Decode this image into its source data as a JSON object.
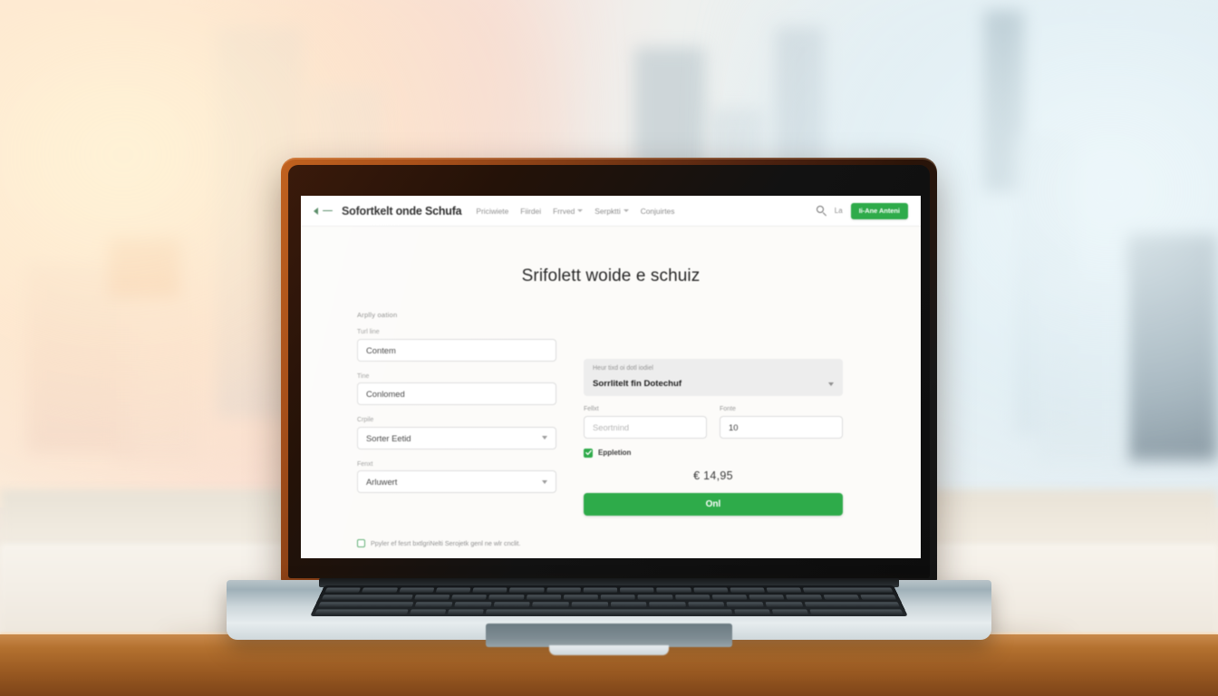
{
  "scene": {
    "description": "laptop on wooden desk in front of blurred city window",
    "accent_green": "#2eab4a",
    "bezel_color": "#a8501a",
    "desk_wood_color": "#b4712f"
  },
  "browser": {
    "nav": {
      "back_icon": "chevron-left-icon",
      "divider_icon": "dash-icon",
      "brand": "Sofortkelt onde Schufa",
      "links": [
        {
          "label": "Priciwiete",
          "has_caret": false
        },
        {
          "label": "Fiirdei",
          "has_caret": false
        },
        {
          "label": "Frrved",
          "has_caret": true
        },
        {
          "label": "Serpktti",
          "has_caret": true
        },
        {
          "label": "Conjuirtes",
          "has_caret": false
        }
      ],
      "search_icon": "search-icon",
      "mini_label": "La",
      "cta_label": "Ii-Ane Anteni"
    }
  },
  "page": {
    "heading": "Srifolett woide e schuiz",
    "left_column": {
      "section_label": "Arplly oation",
      "fields": [
        {
          "label": "Turl line",
          "value": "Contem",
          "type": "text",
          "placeholder": ""
        },
        {
          "label": "Tine",
          "value": "Conlomed",
          "type": "text",
          "placeholder": ""
        },
        {
          "label": "Crpile",
          "value": "Sorter Eetid",
          "type": "select"
        },
        {
          "label": "Fenxt",
          "value": "Arluwert",
          "type": "select"
        }
      ]
    },
    "right_column": {
      "panel": {
        "label": "Heur tixd oi dotl iodiel",
        "selected": "Sorrlitelt fin Dotechuf",
        "chevron_icon": "chevron-down-icon"
      },
      "fields": [
        {
          "label": "Fellxt",
          "value": "",
          "placeholder": "Seortnind",
          "type": "text"
        },
        {
          "label": "Fonte",
          "value": "10",
          "placeholder": "",
          "type": "text"
        }
      ],
      "checkbox": {
        "label": "Eppletion",
        "checked": true,
        "icon": "check-icon"
      },
      "price": "€ 14,95",
      "cta_label": "Onl"
    },
    "footer": {
      "checkbox_checked": false,
      "text": "Ppyler ef fesrt bxtlgriNelti Serojetk genl ne wlr cnclit."
    }
  }
}
